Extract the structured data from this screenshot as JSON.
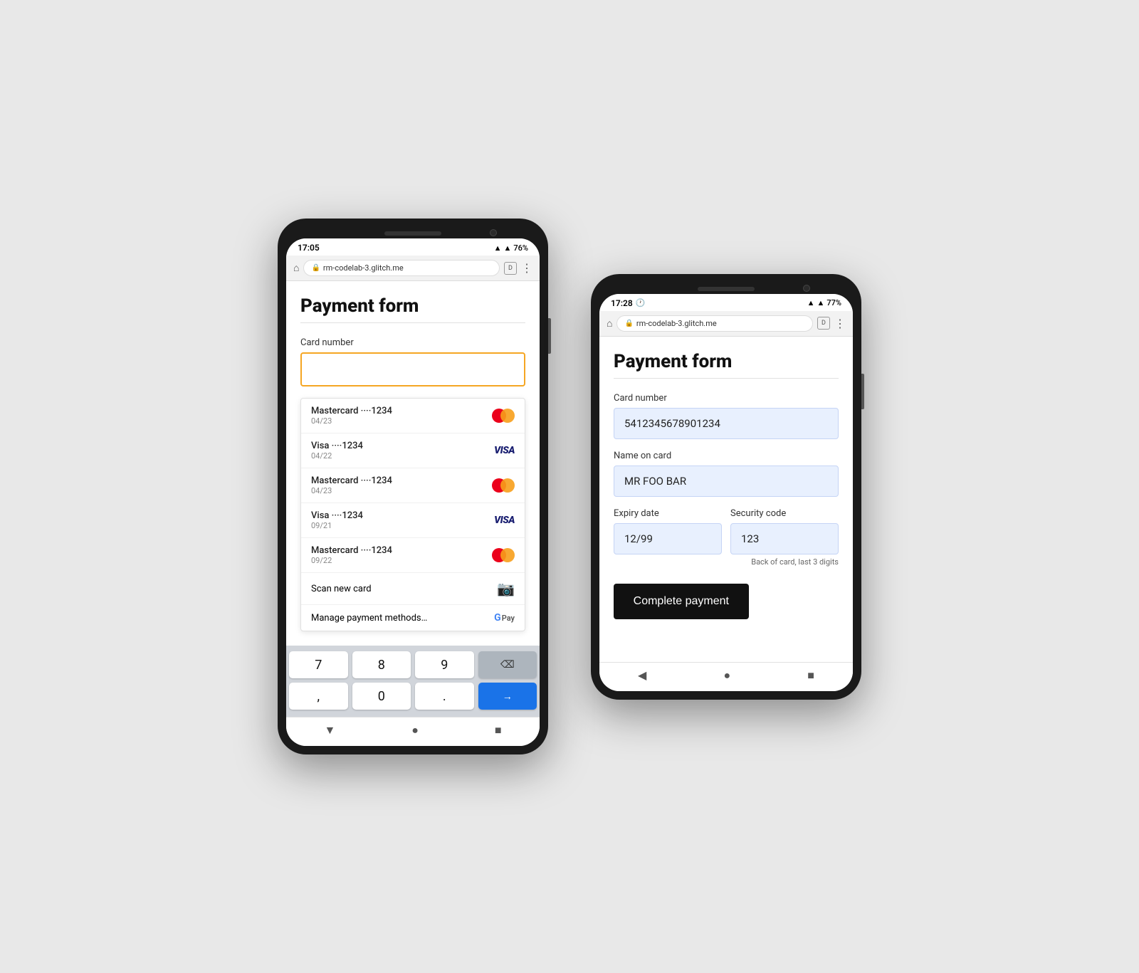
{
  "colors": {
    "accent": "#f5a623",
    "brand_blue": "#1a73e8",
    "dark": "#111111",
    "filled_bg": "#e8f0fe"
  },
  "phone_left": {
    "status_time": "17:05",
    "status_battery": "76%",
    "browser_url": "rm-codelab-3.glitch.me",
    "page_title": "Payment form",
    "card_number_label": "Card number",
    "card_input_placeholder": "",
    "autocomplete_items": [
      {
        "name": "Mastercard ····1234",
        "expiry": "04/23",
        "brand": "mastercard"
      },
      {
        "name": "Visa ····1234",
        "expiry": "04/22",
        "brand": "visa"
      },
      {
        "name": "Mastercard ····1234",
        "expiry": "04/23",
        "brand": "mastercard"
      },
      {
        "name": "Visa ····1234",
        "expiry": "09/21",
        "brand": "visa"
      },
      {
        "name": "Mastercard ····1234",
        "expiry": "09/22",
        "brand": "mastercard"
      }
    ],
    "scan_new_card_label": "Scan new card",
    "manage_payment_label": "Manage payment methods…",
    "keyboard_rows": [
      [
        "7",
        "8",
        "9",
        "⌫"
      ],
      [
        ",",
        "0",
        ".",
        "→"
      ]
    ]
  },
  "phone_right": {
    "status_time": "17:28",
    "status_battery": "77%",
    "browser_url": "rm-codelab-3.glitch.me",
    "page_title": "Payment form",
    "card_number_label": "Card number",
    "card_number_value": "5412345678901234",
    "name_on_card_label": "Name on card",
    "name_on_card_value": "MR FOO BAR",
    "expiry_date_label": "Expiry date",
    "expiry_date_value": "12/99",
    "security_code_label": "Security code",
    "security_code_value": "123",
    "security_hint": "Back of card, last 3 digits",
    "complete_button_label": "Complete payment"
  }
}
